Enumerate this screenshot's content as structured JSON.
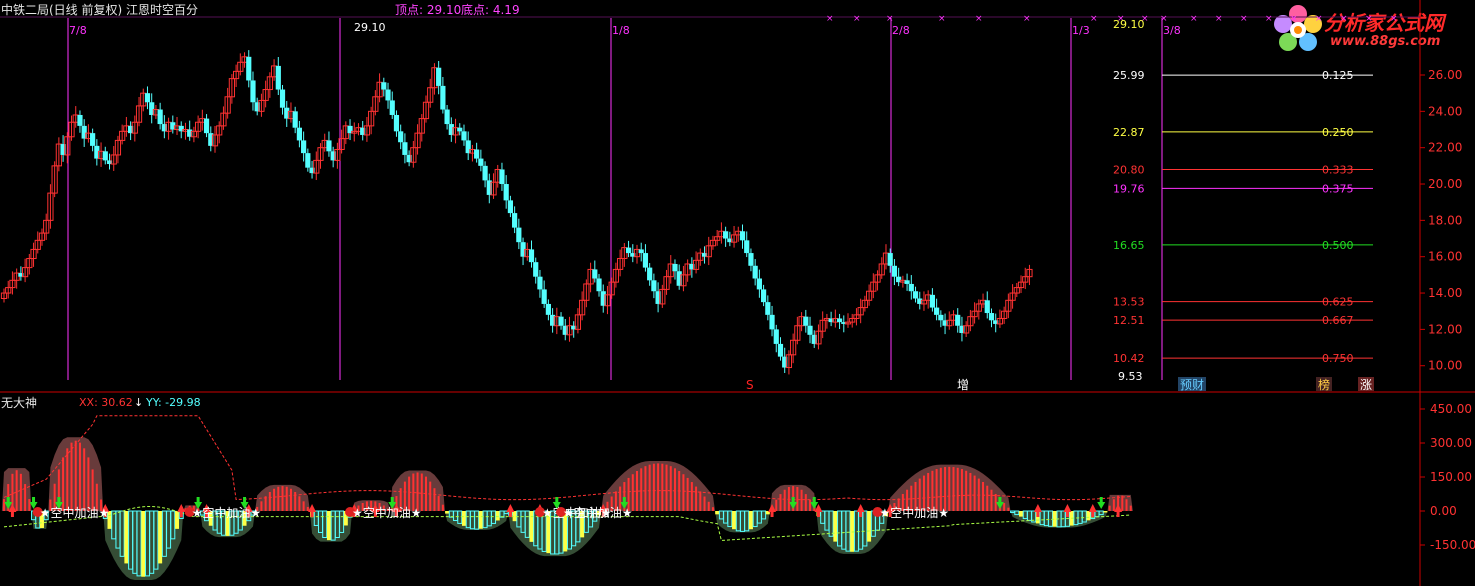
{
  "header": {
    "title": "中铁二局(日线 前复权) 江恩时空百分",
    "top_label": "顶点: 29.10",
    "bottom_label": "底点: 4.19"
  },
  "logo": {
    "title": "分析家公式网",
    "url": "www.88gs.com"
  },
  "colors": {
    "background": "#000000",
    "up": "#ff3232",
    "down": "#54ffff",
    "magenta": "#ff33ff",
    "green": "#22dd22",
    "yellow": "#ffff44",
    "axis": "#cc0000"
  },
  "chart_data": [
    {
      "type": "candlestick",
      "name": "price",
      "y_ticks": [
        10.0,
        12.0,
        14.0,
        16.0,
        18.0,
        20.0,
        22.0,
        24.0,
        26.0
      ],
      "ylim": [
        9.0,
        27.7
      ],
      "time_lines": [
        "7/8",
        "",
        "1/8",
        "2/8",
        "1/3",
        "3/8"
      ],
      "peak_label": "29.10",
      "low_label": "9.53",
      "gann_levels": [
        {
          "price": "29.10",
          "ratio": ""
        },
        {
          "price": "25.99",
          "ratio": "0.125"
        },
        {
          "price": "22.87",
          "ratio": "0.250"
        },
        {
          "price": "20.80",
          "ratio": "0.333"
        },
        {
          "price": "19.76",
          "ratio": "0.375"
        },
        {
          "price": "16.65",
          "ratio": "0.500"
        },
        {
          "price": "13.53",
          "ratio": "0.625"
        },
        {
          "price": "12.51",
          "ratio": "0.667"
        },
        {
          "price": "10.42",
          "ratio": "0.750"
        }
      ],
      "event_markers": [
        "S",
        "增",
        "预财",
        "榜",
        "涨"
      ],
      "closes": [
        14.0,
        14.3,
        14.7,
        15.1,
        14.9,
        15.4,
        15.9,
        16.4,
        16.9,
        17.3,
        18.0,
        19.5,
        21.0,
        22.2,
        21.6,
        22.6,
        23.4,
        23.8,
        23.2,
        22.5,
        22.8,
        22.1,
        21.4,
        21.8,
        21.3,
        21.1,
        21.6,
        22.4,
        22.9,
        23.2,
        22.8,
        23.4,
        24.3,
        25.0,
        24.5,
        23.8,
        24.1,
        23.3,
        22.9,
        23.4,
        23.0,
        23.2,
        22.9,
        23.0,
        22.6,
        22.9,
        23.4,
        23.6,
        22.8,
        22.1,
        22.7,
        23.2,
        23.9,
        24.8,
        25.8,
        26.2,
        26.7,
        27.0,
        25.7,
        24.5,
        24.0,
        24.6,
        25.2,
        25.9,
        26.5,
        25.2,
        24.2,
        23.6,
        24.0,
        23.1,
        22.4,
        21.7,
        20.9,
        20.6,
        21.3,
        22.0,
        22.4,
        21.8,
        21.3,
        21.9,
        22.5,
        23.2,
        22.8,
        22.9,
        23.1,
        22.7,
        23.2,
        24.0,
        24.8,
        25.6,
        25.2,
        24.6,
        23.8,
        22.9,
        22.3,
        21.6,
        21.2,
        22.0,
        22.8,
        23.6,
        24.5,
        25.3,
        26.4,
        25.4,
        24.1,
        23.3,
        22.7,
        23.1,
        22.9,
        22.4,
        21.7,
        21.9,
        21.4,
        21.0,
        20.2,
        19.4,
        20.1,
        20.8,
        20.0,
        19.1,
        18.4,
        17.6,
        16.8,
        16.0,
        16.4,
        15.7,
        14.9,
        14.2,
        13.4,
        12.8,
        12.2,
        12.7,
        12.2,
        11.7,
        12.2,
        12.0,
        12.8,
        13.6,
        14.5,
        15.3,
        14.8,
        14.1,
        13.3,
        13.9,
        14.6,
        15.3,
        15.9,
        16.5,
        16.2,
        16.0,
        16.4,
        16.2,
        15.4,
        14.7,
        14.1,
        13.4,
        14.2,
        14.9,
        15.6,
        15.2,
        14.4,
        15.0,
        15.6,
        15.3,
        15.8,
        16.2,
        16.0,
        16.6,
        16.9,
        17.1,
        17.4,
        17.0,
        16.8,
        17.2,
        17.4,
        16.9,
        16.2,
        15.5,
        14.8,
        14.2,
        13.5,
        12.8,
        12.0,
        11.2,
        10.5,
        9.9,
        10.6,
        11.4,
        12.2,
        12.7,
        12.2,
        11.7,
        11.2,
        11.9,
        12.5,
        12.6,
        12.4,
        12.6,
        12.4,
        12.3,
        12.4,
        12.6,
        12.8,
        13.2,
        13.6,
        14.1,
        14.6,
        15.0,
        15.6,
        16.2,
        15.5,
        14.9,
        14.6,
        14.7,
        14.5,
        14.1,
        13.7,
        13.4,
        13.6,
        13.9,
        13.2,
        12.8,
        12.5,
        12.2,
        12.5,
        12.8,
        12.2,
        11.8,
        12.2,
        12.7,
        13.0,
        13.4,
        13.6,
        12.9,
        12.5,
        12.3,
        12.6,
        13.0,
        13.6,
        14.0,
        14.3,
        14.6,
        14.9,
        15.3
      ]
    },
    {
      "type": "bar",
      "name": "无大神",
      "title": "无大神",
      "series": [
        {
          "name": "XX",
          "label": "XX: 30.62"
        },
        {
          "name": "YY",
          "label": "YY: -29.98"
        }
      ],
      "y_ticks": [
        450.0,
        300.0,
        150.0,
        0.0,
        -150.0
      ],
      "ylim": [
        -200,
        460
      ],
      "signal_label": "★空中加油★",
      "segments": [
        {
          "start": 0,
          "end": 7,
          "sign": 1,
          "peak": 180
        },
        {
          "start": 7,
          "end": 11,
          "sign": -1,
          "peak": 80
        },
        {
          "start": 11,
          "end": 24,
          "sign": 1,
          "peak": 310
        },
        {
          "start": 24,
          "end": 43,
          "sign": -1,
          "peak": 290
        },
        {
          "start": 43,
          "end": 47,
          "sign": 1,
          "peak": 25
        },
        {
          "start": 47,
          "end": 60,
          "sign": -1,
          "peak": 110
        },
        {
          "start": 60,
          "end": 73,
          "sign": 1,
          "peak": 110
        },
        {
          "start": 73,
          "end": 83,
          "sign": -1,
          "peak": 130
        },
        {
          "start": 83,
          "end": 92,
          "sign": 1,
          "peak": 45
        },
        {
          "start": 92,
          "end": 105,
          "sign": 1,
          "peak": 170
        },
        {
          "start": 105,
          "end": 120,
          "sign": -1,
          "peak": 80
        },
        {
          "start": 120,
          "end": 142,
          "sign": -1,
          "peak": 190
        },
        {
          "start": 142,
          "end": 169,
          "sign": 1,
          "peak": 210
        },
        {
          "start": 169,
          "end": 182,
          "sign": -1,
          "peak": 90
        },
        {
          "start": 182,
          "end": 193,
          "sign": 1,
          "peak": 110
        },
        {
          "start": 193,
          "end": 210,
          "sign": -1,
          "peak": 180
        },
        {
          "start": 210,
          "end": 239,
          "sign": 1,
          "peak": 195
        },
        {
          "start": 239,
          "end": 262,
          "sign": -1,
          "peak": 70
        },
        {
          "start": 262,
          "end": 268,
          "sign": 1,
          "peak": 70
        }
      ],
      "arrow_up_bars": [
        2,
        24,
        42,
        48,
        58,
        73,
        83,
        88,
        93,
        120,
        127,
        142,
        182,
        193,
        203,
        210,
        245,
        252,
        258,
        264
      ],
      "arrow_down_bars": [
        1,
        7,
        13,
        46,
        57,
        92,
        131,
        147,
        187,
        192,
        236,
        260
      ],
      "label_bars": [
        8,
        44,
        82,
        127,
        132,
        207
      ]
    }
  ]
}
